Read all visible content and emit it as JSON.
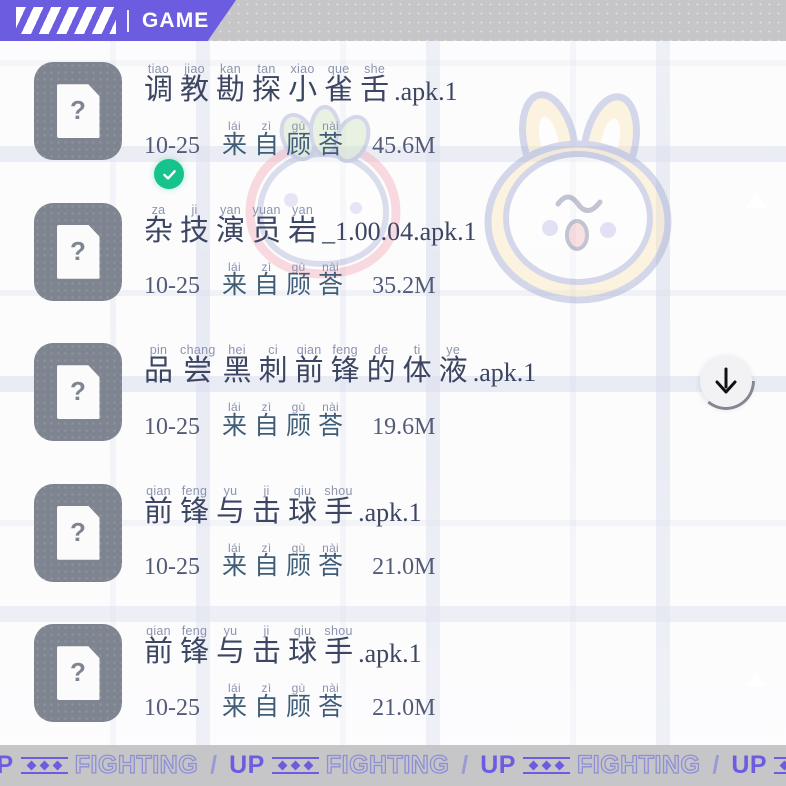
{
  "header": {
    "title": "GAME",
    "stripes_icon": "diagonal-stripes-icon",
    "divider": "|"
  },
  "files": [
    {
      "icon": "unknown-file-icon",
      "question_mark": "?",
      "ruby_title": [
        {
          "pinyin": "tiao",
          "han": "调"
        },
        {
          "pinyin": "jiao",
          "han": "教"
        },
        {
          "pinyin": "kan",
          "han": "勘"
        },
        {
          "pinyin": "tan",
          "han": "探"
        },
        {
          "pinyin": "xiao",
          "han": "小"
        },
        {
          "pinyin": "que",
          "han": "雀"
        },
        {
          "pinyin": "she",
          "han": "舌"
        }
      ],
      "extension": ".apk.1",
      "date": "10-25",
      "source_ruby": [
        {
          "pinyin": "lái",
          "han": "来"
        },
        {
          "pinyin": "zì",
          "han": "自"
        },
        {
          "pinyin": "gù",
          "han": "顾"
        },
        {
          "pinyin": "nài",
          "han": "荅"
        }
      ],
      "size": "45.6M",
      "verified": true
    },
    {
      "icon": "unknown-file-icon",
      "question_mark": "?",
      "ruby_title": [
        {
          "pinyin": "za",
          "han": "杂"
        },
        {
          "pinyin": "ji",
          "han": "技"
        },
        {
          "pinyin": "yan",
          "han": "演"
        },
        {
          "pinyin": "yuan",
          "han": "员"
        },
        {
          "pinyin": "yan",
          "han": "岩"
        }
      ],
      "extension": "_1.00.04.apk.1",
      "date": "10-25",
      "source_ruby": [
        {
          "pinyin": "lái",
          "han": "来"
        },
        {
          "pinyin": "zì",
          "han": "自"
        },
        {
          "pinyin": "gù",
          "han": "顾"
        },
        {
          "pinyin": "nài",
          "han": "荅"
        }
      ],
      "size": "35.2M",
      "verified": false
    },
    {
      "icon": "unknown-file-icon",
      "question_mark": "?",
      "ruby_title": [
        {
          "pinyin": "pin",
          "han": "品"
        },
        {
          "pinyin": "chang",
          "han": "尝"
        },
        {
          "pinyin": "hei",
          "han": "黑"
        },
        {
          "pinyin": "ci",
          "han": "刺"
        },
        {
          "pinyin": "qian",
          "han": "前"
        },
        {
          "pinyin": "feng",
          "han": "锋"
        },
        {
          "pinyin": "de",
          "han": "的"
        },
        {
          "pinyin": "ti",
          "han": "体"
        },
        {
          "pinyin": "ye",
          "han": "液"
        }
      ],
      "extension": ".apk.1",
      "date": "10-25",
      "source_ruby": [
        {
          "pinyin": "lái",
          "han": "来"
        },
        {
          "pinyin": "zì",
          "han": "自"
        },
        {
          "pinyin": "gù",
          "han": "顾"
        },
        {
          "pinyin": "nài",
          "han": "荅"
        }
      ],
      "size": "19.6M",
      "verified": false
    },
    {
      "icon": "unknown-file-icon",
      "question_mark": "?",
      "ruby_title": [
        {
          "pinyin": "qian",
          "han": "前"
        },
        {
          "pinyin": "feng",
          "han": "锋"
        },
        {
          "pinyin": "yu",
          "han": "与"
        },
        {
          "pinyin": "ji",
          "han": "击"
        },
        {
          "pinyin": "qiu",
          "han": "球"
        },
        {
          "pinyin": "shou",
          "han": "手"
        }
      ],
      "extension": ".apk.1",
      "date": "10-25",
      "source_ruby": [
        {
          "pinyin": "lái",
          "han": "来"
        },
        {
          "pinyin": "zì",
          "han": "自"
        },
        {
          "pinyin": "gù",
          "han": "顾"
        },
        {
          "pinyin": "nài",
          "han": "荅"
        }
      ],
      "size": "21.0M",
      "verified": false
    },
    {
      "icon": "unknown-file-icon",
      "question_mark": "?",
      "ruby_title": [
        {
          "pinyin": "qian",
          "han": "前"
        },
        {
          "pinyin": "feng",
          "han": "锋"
        },
        {
          "pinyin": "yu",
          "han": "与"
        },
        {
          "pinyin": "ji",
          "han": "击"
        },
        {
          "pinyin": "qiu",
          "han": "球"
        },
        {
          "pinyin": "shou",
          "han": "手"
        }
      ],
      "extension": ".apk.1",
      "date": "10-25",
      "source_ruby": [
        {
          "pinyin": "lái",
          "han": "来"
        },
        {
          "pinyin": "zì",
          "han": "自"
        },
        {
          "pinyin": "gù",
          "han": "顾"
        },
        {
          "pinyin": "nài",
          "han": "荅"
        }
      ],
      "size": "21.0M",
      "verified": false
    }
  ],
  "download_fab": {
    "icon": "download-arrow-icon",
    "progress_percent": 36
  },
  "banner": {
    "word_up": "UP",
    "word_fighting": "FIGHTING",
    "slash": "/",
    "repeat": 4
  },
  "stickers": [
    {
      "name": "strawberry-sticker"
    },
    {
      "name": "bunny-sticker"
    }
  ],
  "colors": {
    "brand_purple": "#6c5ce0",
    "verified_green": "#16c38c",
    "icon_gray": "#7e8590",
    "plaid_line": "#c5cbe2",
    "banner_gray": "#c6c6c9",
    "text_dark": "#3c4663"
  }
}
